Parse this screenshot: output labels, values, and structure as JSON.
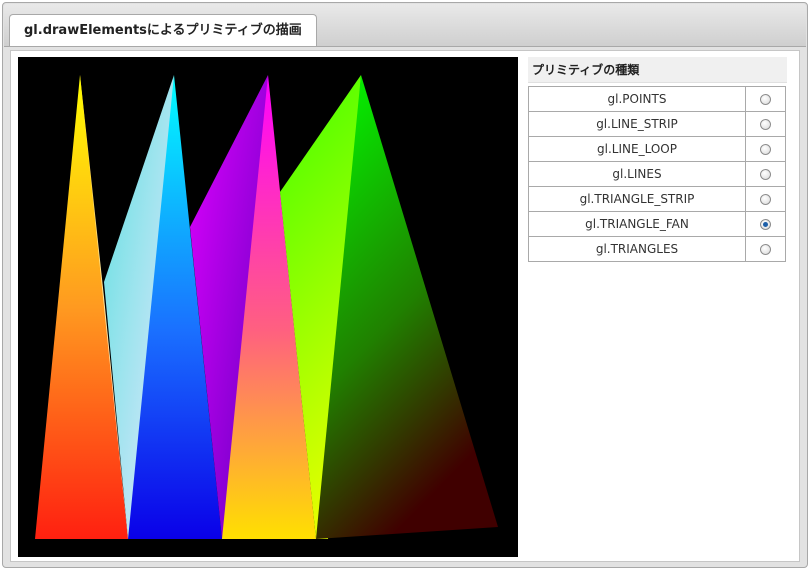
{
  "tab": {
    "label": "gl.drawElementsによるプリミティブの描画"
  },
  "side": {
    "title": "プリミティブの種類"
  },
  "primitives": [
    {
      "label": "gl.POINTS",
      "checked": false
    },
    {
      "label": "gl.LINE_STRIP",
      "checked": false
    },
    {
      "label": "gl.LINE_LOOP",
      "checked": false
    },
    {
      "label": "gl.LINES",
      "checked": false
    },
    {
      "label": "gl.TRIANGLE_STRIP",
      "checked": false
    },
    {
      "label": "gl.TRIANGLE_FAN",
      "checked": true
    },
    {
      "label": "gl.TRIANGLES",
      "checked": false
    }
  ],
  "colors": {
    "canvas_bg": "#000000",
    "selected_radio": "#1e5fa8"
  }
}
